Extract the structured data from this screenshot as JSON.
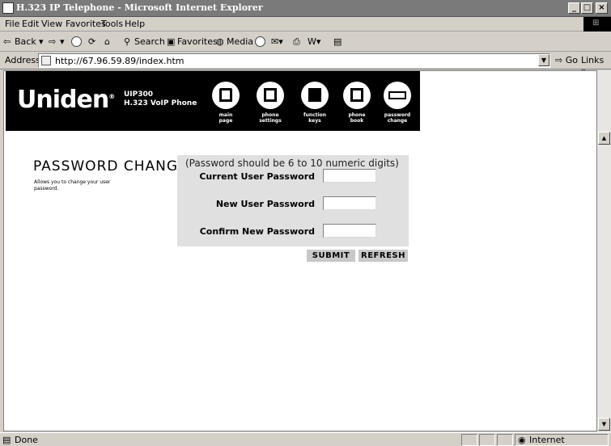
{
  "window": {
    "title": "H.323 IP Telephone - Microsoft Internet Explorer",
    "minimize": "_",
    "maximize": "□",
    "close": "×"
  },
  "menu": [
    "File",
    "Edit",
    "View",
    "Favorites",
    "Tools",
    "Help"
  ],
  "toolbar": {
    "back": "Back",
    "search": "Search",
    "favorites": "Favorites",
    "media": "Media"
  },
  "address": {
    "label": "Address",
    "url": "http://67.96.59.89/index.htm",
    "go": "Go",
    "links": "Links »"
  },
  "banner": {
    "logo": "Uniden",
    "model_line1": "UIP300",
    "model_line2": "H.323 VoIP Phone",
    "nav": [
      {
        "line1": "main",
        "line2": "page",
        "icon": "home-icon"
      },
      {
        "line1": "phone",
        "line2": "settings",
        "icon": "phone-icon"
      },
      {
        "line1": "function",
        "line2": "keys",
        "icon": "function-key-icon"
      },
      {
        "line1": "phone",
        "line2": "book",
        "icon": "book-icon"
      },
      {
        "line1": "password",
        "line2": "change",
        "icon": "password-icon"
      }
    ]
  },
  "page": {
    "title": "PASSWORD CHANGE",
    "description": "Allows you to change your user password."
  },
  "form": {
    "hint": "(Password should be 6 to 10 numeric digits)",
    "current_label": "Current User Password",
    "new_label": "New User Password",
    "confirm_label": "Confirm New Password",
    "current_value": "",
    "new_value": "",
    "confirm_value": "",
    "submit": "SUBMIT",
    "refresh": "REFRESH"
  },
  "status": {
    "text": "Done",
    "zone": "Internet"
  }
}
